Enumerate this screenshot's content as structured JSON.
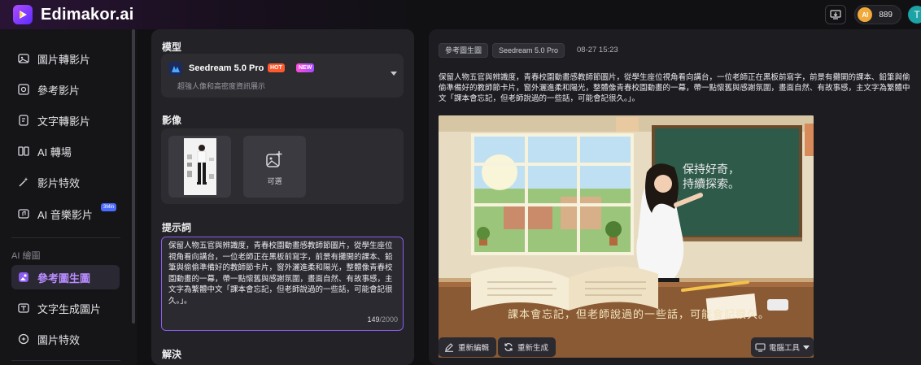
{
  "app": {
    "name": "Edimakor.ai",
    "credits": "889",
    "coin_label": "AI",
    "avatar_initial": "T"
  },
  "sidebar": {
    "items": [
      {
        "label": "圖片轉影片",
        "icon": "image-to-video-icon"
      },
      {
        "label": "參考影片",
        "icon": "reference-video-icon"
      },
      {
        "label": "文字轉影片",
        "icon": "text-to-video-icon"
      },
      {
        "label": "AI 轉場",
        "icon": "transition-icon"
      },
      {
        "label": "影片特效",
        "icon": "effects-icon"
      },
      {
        "label": "AI 音樂影片",
        "icon": "music-video-icon",
        "badge": "3Min"
      }
    ],
    "section_label": "AI 繪圖",
    "drawing_items": [
      {
        "label": "參考圖生圖",
        "icon": "reference-image-icon",
        "active": true
      },
      {
        "label": "文字生成圖片",
        "icon": "text-to-image-icon"
      },
      {
        "label": "圖片特效",
        "icon": "image-effects-icon"
      }
    ]
  },
  "left_panel": {
    "model_label": "模型",
    "model": {
      "name": "Seedream 5.0 Pro",
      "hot": "HOT",
      "new": "NEW",
      "desc": "超強人像和高密度資訊展示"
    },
    "image_label": "影像",
    "add_label": "可選",
    "prompt_label": "提示詞",
    "prompt_text": "保留人物五官與辨識度，青春校園動畫感教師節圖片，從學生座位視角看向講台，一位老師正在黑板前寫字，前景有攤開的課本、鉛筆與偷偷準備好的教師節卡片，窗外灑進柔和陽光，整體像青春校園動畫的一幕，帶一點懷舊與感謝氛圍，畫面自然、有故事感，主文字為繁體中文「課本會忘記，但老師說過的一些話，可能會記很久。」。",
    "prompt_count": "149",
    "prompt_max": "/2000",
    "resolution_label": "解決"
  },
  "right_panel": {
    "chips": [
      "參考圖生圖",
      "Seedream 5.0 Pro"
    ],
    "timestamp": "08-27 15:23",
    "result_text": "保留人物五官與辨識度，青春校園動畫感教師節圖片，從學生座位視角看向講台，一位老師正在黑板前寫字，前景有攤開的課本、鉛筆與偷偷準備好的教師節卡片，窗外灑進柔和陽光，整體像青春校園動畫的一幕，帶一點懷舊與感謝氛圍，畫面自然、有故事感，主文字為繁體中文「課本會忘記，但老師說過的一些話，可能會記很久。」。",
    "image_caption": "課本會忘記，但老師說過的一些話，可能會記很久。",
    "board_line1": "保持好奇，",
    "board_line2": "持續探索。",
    "actions": {
      "re_edit": "重新編輯",
      "regenerate": "重新生成",
      "tools": "電腦工具"
    }
  },
  "colors": {
    "accent": "#8a5cf0",
    "active_text": "#b88cff",
    "hot": "#ff5a2e"
  }
}
